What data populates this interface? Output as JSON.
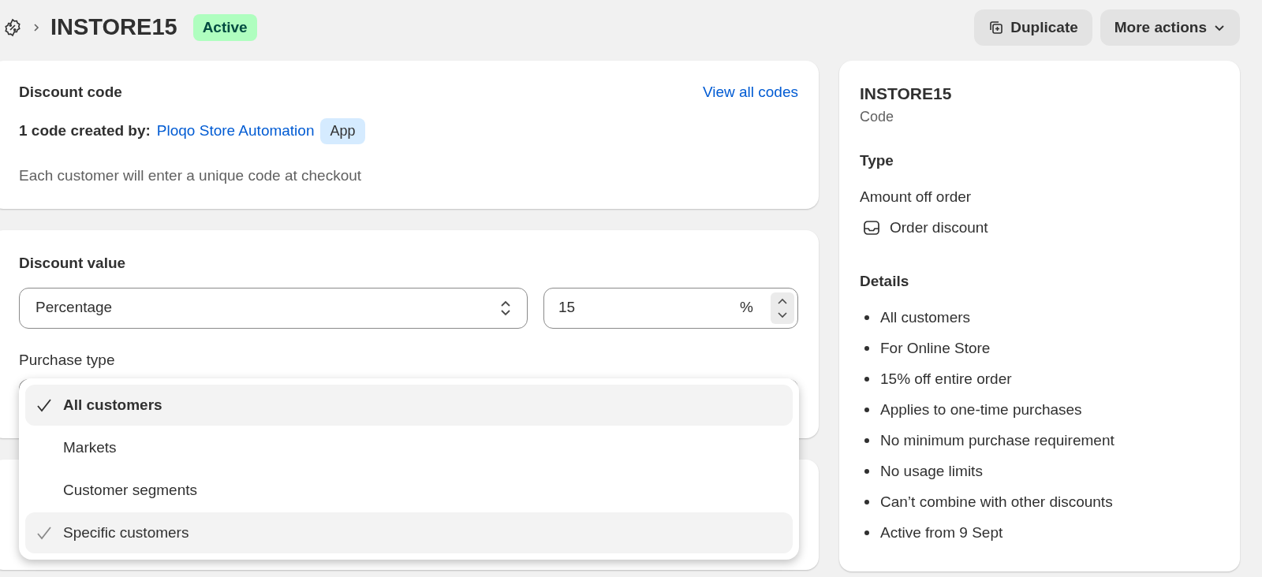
{
  "header": {
    "code": "INSTORE15",
    "status": "Active",
    "actions": [
      {
        "label": "Duplicate",
        "kind": "duplicate"
      },
      {
        "label": "More actions",
        "kind": "menu"
      }
    ]
  },
  "discount_code_card": {
    "title": "Discount code",
    "link": "View all codes",
    "created_by_label": "1 code created by:",
    "creator": "Ploqo Store Automation",
    "creator_badge": "App",
    "note": "Each customer will enter a unique code at checkout"
  },
  "discount_value_card": {
    "title": "Discount value",
    "type_select": {
      "value": "Percentage"
    },
    "amount_field": {
      "value": "15",
      "suffix": "%"
    },
    "purchase_type_label": "Purchase type",
    "dropdown": [
      {
        "label": "All customers",
        "checked": true,
        "selected": true
      },
      {
        "label": "Markets",
        "checked": false,
        "selected": false
      },
      {
        "label": "Customer segments",
        "checked": false,
        "selected": false
      },
      {
        "label": "Specific customers",
        "checked": true,
        "selected": false
      }
    ]
  },
  "summary": {
    "code": "INSTORE15",
    "code_label": "Code",
    "type_heading": "Type",
    "type": "Amount off order",
    "type_detail": "Order discount",
    "details_heading": "Details",
    "details": [
      "All customers",
      "For Online Store",
      "15% off entire order",
      "Applies to one-time purchases",
      "No minimum purchase requirement",
      "No usage limits",
      "Can’t combine with other discounts",
      "Active from 9 Sept"
    ]
  }
}
